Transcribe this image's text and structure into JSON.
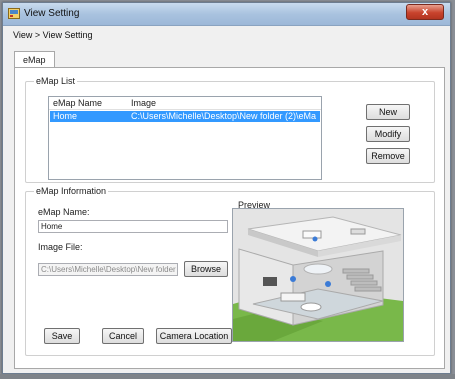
{
  "window": {
    "title": "View Setting",
    "close_label": "x"
  },
  "breadcrumb": "View > View Setting",
  "tabs": [
    {
      "label": "eMap"
    }
  ],
  "emap_list": {
    "group_label": "eMap List",
    "columns": [
      "eMap Name",
      "Image"
    ],
    "rows": [
      {
        "name": "Home",
        "image": "C:\\Users\\Michelle\\Desktop\\New folder (2)\\eMa"
      }
    ],
    "buttons": {
      "new": "New",
      "modify": "Modify",
      "remove": "Remove"
    }
  },
  "emap_info": {
    "group_label": "eMap Information",
    "name_label": "eMap Name:",
    "name_value": "Home",
    "file_label": "Image File:",
    "file_value": "C:\\Users\\Michelle\\Desktop\\New folder",
    "browse_label": "Browse",
    "preview_label": "Preview"
  },
  "footer_buttons": {
    "save": "Save",
    "cancel": "Cancel",
    "camera_location": "Camera Location"
  }
}
